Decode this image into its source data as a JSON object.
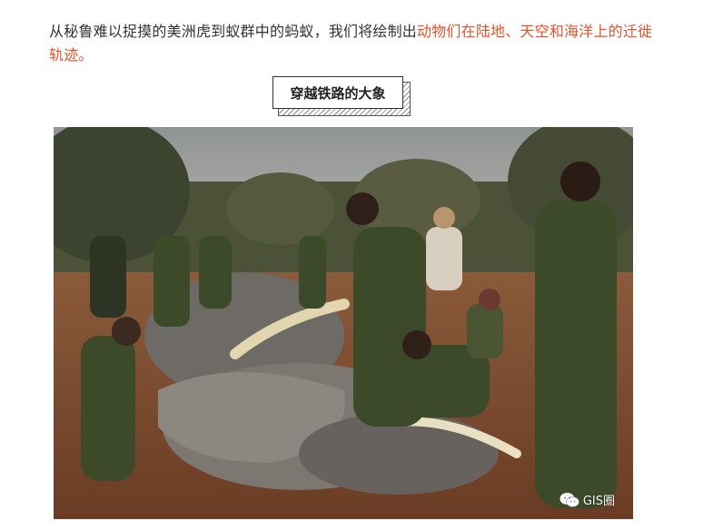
{
  "article": {
    "intro_text": "从秘鲁难以捉摸的美洲虎到蚁群中的蚂蚁，我们将绘制出",
    "intro_highlight": "动物们在陆地、天空和海洋上的迁徙轨迹。",
    "section_title": "穿越铁路的大象"
  },
  "watermark": {
    "icon": "wechat-icon",
    "text": "GIS圈"
  },
  "colors": {
    "text": "#333333",
    "highlight": "#e8502a"
  }
}
